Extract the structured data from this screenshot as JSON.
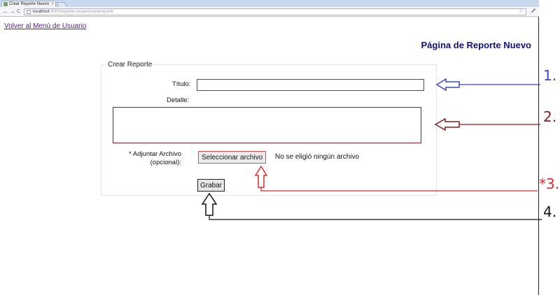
{
  "browser": {
    "tab_title": "Crear Reporte Nuevo",
    "tab_close": "×",
    "url_host": "localhost",
    "url_rest": ":9000/reporte.usuario/crearreporte",
    "back_glyph": "←",
    "forward_glyph": "→",
    "reload_glyph": "C",
    "star_glyph": "☆",
    "wrench_glyph": "🔧"
  },
  "page": {
    "back_link": "Volver al Menú de Usuario",
    "title": "Página de Reporte Nuevo"
  },
  "form": {
    "legend": "Crear Reporte",
    "titulo_label": "Título:",
    "titulo_value": "",
    "detalle_label": "Detalle:",
    "detalle_value": "",
    "adjuntar_label_line1": "* Adjuntar Archivo",
    "adjuntar_label_line2": "(opcional):",
    "file_button": "Seleccionar archivo",
    "file_status": "No se eligió ningún archivo",
    "submit_button": "Grabar"
  },
  "annotations": {
    "n1": "1.",
    "n2": "2.",
    "n3": "*3.",
    "n4": "4.",
    "colors": {
      "n1": "#3a47c0",
      "n2": "#8b1a1a",
      "n3": "#e02b2b",
      "n4": "#111111"
    }
  }
}
